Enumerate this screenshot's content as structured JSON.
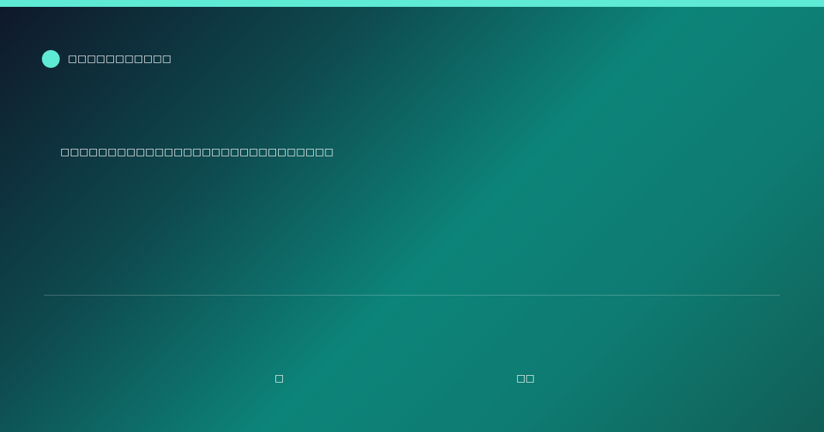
{
  "brand": {
    "name": "□□□□□□□□□□□"
  },
  "headline": {
    "text": "□□□□□□□□□□□□□□□□□□□□□□□□□□□□□"
  },
  "footer": {
    "left_text": "□",
    "right_text": "□□"
  },
  "colors": {
    "accent": "#5eead4",
    "background_start": "#0f172a",
    "background_mid": "#0d8479",
    "background_end": "#115e56"
  }
}
